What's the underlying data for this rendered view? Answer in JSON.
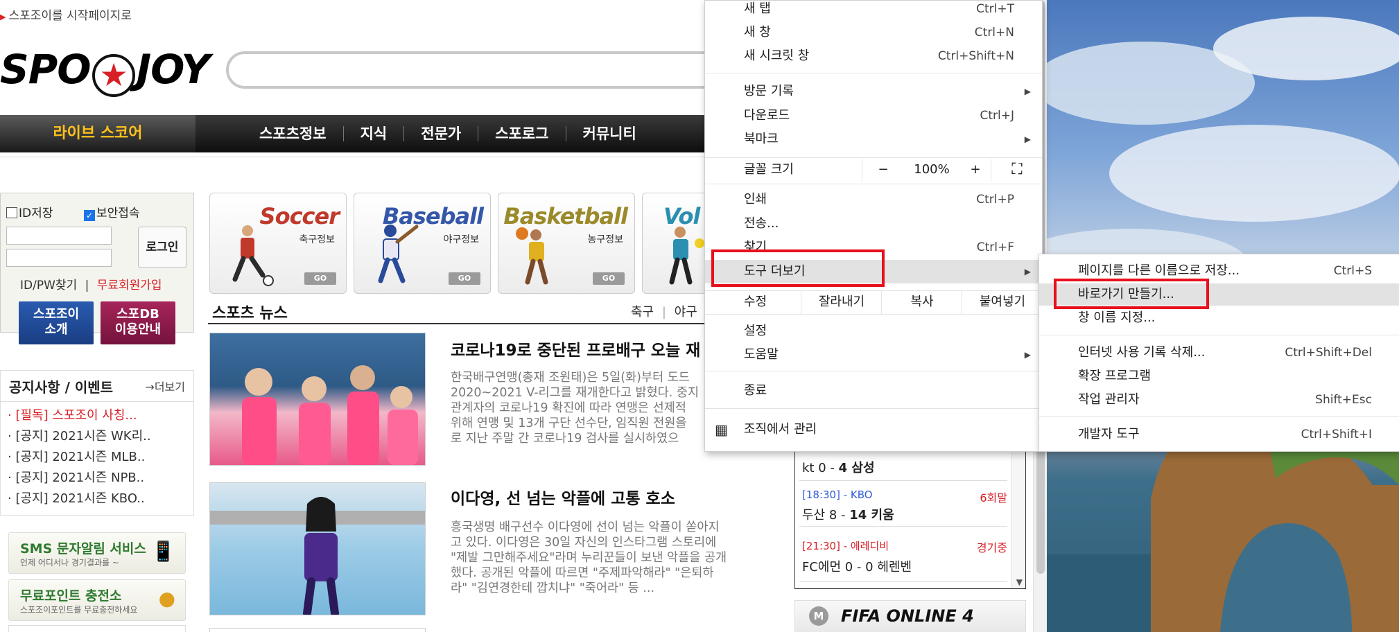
{
  "site": {
    "start_page_link": "스포조이를 시작페이지로",
    "logo_text_left": "SPO",
    "logo_text_right": "JOY",
    "nav": {
      "live_score": "라이브 스코어",
      "items": [
        "스포츠정보",
        "지식",
        "전문가",
        "스포로그",
        "커뮤니티"
      ]
    },
    "login": {
      "save_id": "ID저장",
      "secure_login": "보안접속",
      "login_button": "로그인",
      "find_idpw": "ID/PW찾기",
      "separator": "|",
      "free_join": "무료회원가입",
      "btn_intro": "스포조이\n소개",
      "btn_intro_l1": "스포조이",
      "btn_intro_l2": "소개",
      "btn_db_l1": "스포DB",
      "btn_db_l2": "이용안내"
    },
    "notice": {
      "title": "공지사항 / 이벤트",
      "more": "→더보기",
      "items": [
        "· [필독] 스포조이 사칭...",
        "· [공지] 2021시즌 WK리..",
        "· [공지] 2021시즌 MLB..",
        "· [공지] 2021시즌 NPB..",
        "· [공지] 2021시즌 KBO.."
      ]
    },
    "promos": [
      {
        "title": "SMS 문자알림 서비스",
        "sub": "언제 어디서나 경기결과를 ~"
      },
      {
        "title": "무료포인트 충전소",
        "sub": "스포조이포인트를 무료충전하세요"
      }
    ],
    "cards": [
      {
        "en": "Soccer",
        "ko": "축구정보",
        "go": "GO",
        "color": "#c0392b"
      },
      {
        "en": "Baseball",
        "ko": "야구정보",
        "go": "GO",
        "color": "#3457a8"
      },
      {
        "en": "Basketball",
        "ko": "농구정보",
        "go": "GO",
        "color": "#9a8a2a"
      },
      {
        "en": "Vol",
        "ko": "",
        "go": "",
        "color": "#2a8fb0"
      }
    ],
    "news": {
      "title": "스포츠 뉴스",
      "tab1": "축구",
      "tab_sep": "|",
      "tab2": "야구",
      "items": [
        {
          "title": "코로나19로 중단된 프로배구 오늘 재",
          "body": [
            "한국배구연맹(총재 조원태)은 5일(화)부터 도드",
            "2020~2021 V-리그를 재개한다고 밝혔다. 중지",
            "관계자의 코로나19 확진에 따라 연맹은 선제적",
            "위해 연맹 및 13개 구단 선수단, 임직원 전원을",
            "로 지난 주말 간 코로나19 검사를 실시하였으"
          ]
        },
        {
          "title": "이다영, 선 넘는 악플에 고통 호소",
          "body": [
            "흥국생명 배구선수 이다영에 선이 넘는 악플이 쏟아지",
            "고 있다. 이다영은 30일 자신의 인스타그램 스토리에",
            "\"제발 그만해주세요\"라며 누리꾼들이 보낸 악플을 공개",
            "했다. 공개된 악플에 따르면 \"주제파악해라\" \"은퇴하",
            "라\" \"김연경한테 깝치냐\" \"죽어라\" 등 ..."
          ]
        }
      ]
    },
    "scores": [
      {
        "league": "",
        "state": "",
        "line_pre": "kt 0 - ",
        "line_bold": "4 삼성",
        "league_red": false
      },
      {
        "league": "[18:30] - KBO",
        "state": "6회말",
        "line_pre": "두산 8 - ",
        "line_bold": "14 키움",
        "league_red": false
      },
      {
        "league": "[21:30] - 에레디비",
        "state": "경기중",
        "line_pre": "FC에먼 0 - 0 헤렌벤",
        "line_bold": "",
        "league_red": true
      }
    ],
    "banner": "FIFA ONLINE 4"
  },
  "menu": {
    "items": [
      {
        "label": "새 탭",
        "shortcut": "Ctrl+T"
      },
      {
        "label": "새 창",
        "shortcut": "Ctrl+N"
      },
      {
        "label": "새 시크릿 창",
        "shortcut": "Ctrl+Shift+N"
      },
      {
        "label": "방문 기록",
        "shortcut": ""
      },
      {
        "label": "다운로드",
        "shortcut": "Ctrl+J"
      },
      {
        "label": "북마크",
        "shortcut": ""
      },
      {
        "label": "인쇄",
        "shortcut": "Ctrl+P"
      },
      {
        "label": "전송...",
        "shortcut": ""
      },
      {
        "label": "찾기",
        "shortcut": "Ctrl+F"
      },
      {
        "label": "도구 더보기",
        "shortcut": ""
      },
      {
        "label": "설정",
        "shortcut": ""
      },
      {
        "label": "도움말",
        "shortcut": ""
      },
      {
        "label": "종료",
        "shortcut": ""
      },
      {
        "label": "조직에서 관리",
        "shortcut": ""
      }
    ],
    "zoom": {
      "label": "글꼴 크기",
      "minus": "−",
      "value": "100%",
      "plus": "+",
      "fullscreen": "⛶"
    },
    "edit": {
      "label": "수정",
      "cut": "잘라내기",
      "copy": "복사",
      "paste": "붙여넣기"
    }
  },
  "submenu": {
    "items": [
      {
        "label": "페이지를 다른 이름으로 저장...",
        "shortcut": "Ctrl+S"
      },
      {
        "label": "바로가기 만들기...",
        "shortcut": ""
      },
      {
        "label": "창 이름 지정...",
        "shortcut": ""
      },
      {
        "label": "인터넷 사용 기록 삭제...",
        "shortcut": "Ctrl+Shift+Del"
      },
      {
        "label": "확장 프로그램",
        "shortcut": ""
      },
      {
        "label": "작업 관리자",
        "shortcut": "Shift+Esc"
      },
      {
        "label": "개발자 도구",
        "shortcut": "Ctrl+Shift+I"
      }
    ]
  },
  "colors": {
    "highlight_box": "#e8101c",
    "accent_orange": "#ffc21a",
    "brand_red": "#d81f26"
  }
}
